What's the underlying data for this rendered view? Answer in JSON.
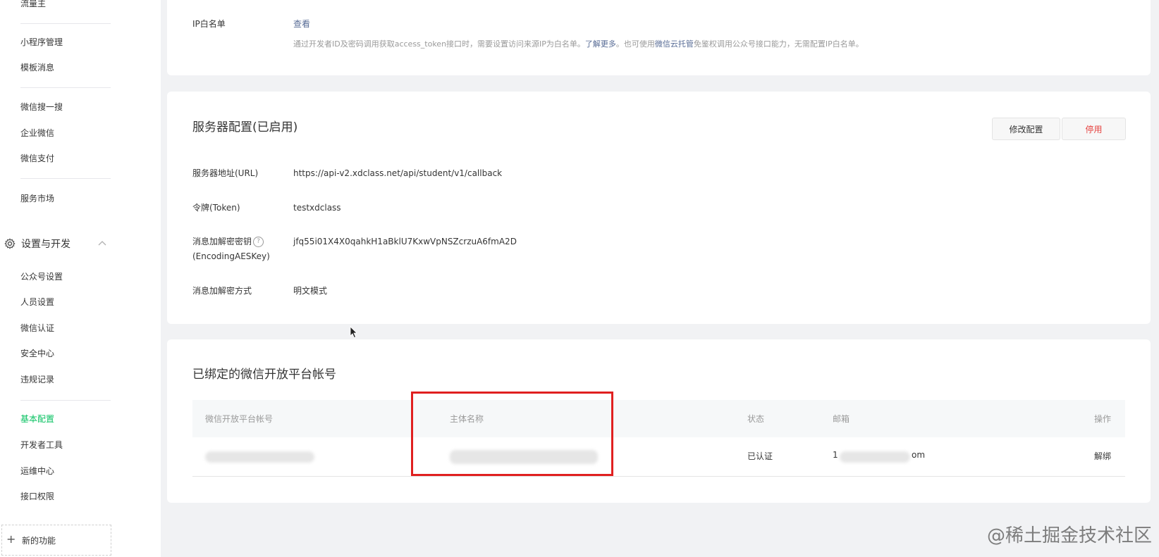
{
  "sidebar": {
    "top_item": "流量主",
    "group1": [
      "小程序管理",
      "模板消息"
    ],
    "group2": [
      "微信搜一搜",
      "企业微信",
      "微信支付"
    ],
    "group3": [
      "服务市场"
    ],
    "section_title": "设置与开发",
    "section_items": [
      "公众号设置",
      "人员设置",
      "微信认证",
      "安全中心",
      "违规记录"
    ],
    "group4": [
      "基本配置",
      "开发者工具",
      "运维中心",
      "接口权限"
    ],
    "active_item": "基本配置",
    "new_function": "新的功能"
  },
  "ip_whitelist": {
    "label": "IP白名单",
    "view_link": "查看",
    "desc_part1": "通过开发者ID及密码调用获取access_token接口时，需要设置访问来源IP为白名单。",
    "desc_link1": "了解更多",
    "desc_part2": "。也可使用",
    "desc_link2": "微信云托管",
    "desc_part3": "免鉴权调用公众号接口能力，无需配置IP白名单。"
  },
  "server_config": {
    "title": "服务器配置(已启用)",
    "edit_button": "修改配置",
    "disable_button": "停用",
    "url_label": "服务器地址(URL)",
    "url_value": "https://api-v2.xdclass.net/api/student/v1/callback",
    "token_label": "令牌(Token)",
    "token_value": "testxdclass",
    "aes_label_line1": "消息加解密密钥",
    "aes_label_line2": "(EncodingAESKey)",
    "aes_help": "?",
    "aes_value": "jfq55i01X4X0qahkH1aBklU7KxwVpNSZcrzuA6fmA2D",
    "mode_label": "消息加解密方式",
    "mode_value": "明文模式"
  },
  "open_platform": {
    "title": "已绑定的微信开放平台帐号",
    "columns": [
      "微信开放平台帐号",
      "主体名称",
      "状态",
      "邮箱",
      "操作"
    ],
    "row": {
      "account": "",
      "entity": "",
      "status": "已认证",
      "email_start": "1",
      "email_end": "om",
      "action": "解绑"
    }
  },
  "watermark": "@稀土掘金技术社区",
  "icons": [
    "gear-icon",
    "chevron-up-icon",
    "help-icon",
    "plus-icon",
    "cursor-icon"
  ]
}
